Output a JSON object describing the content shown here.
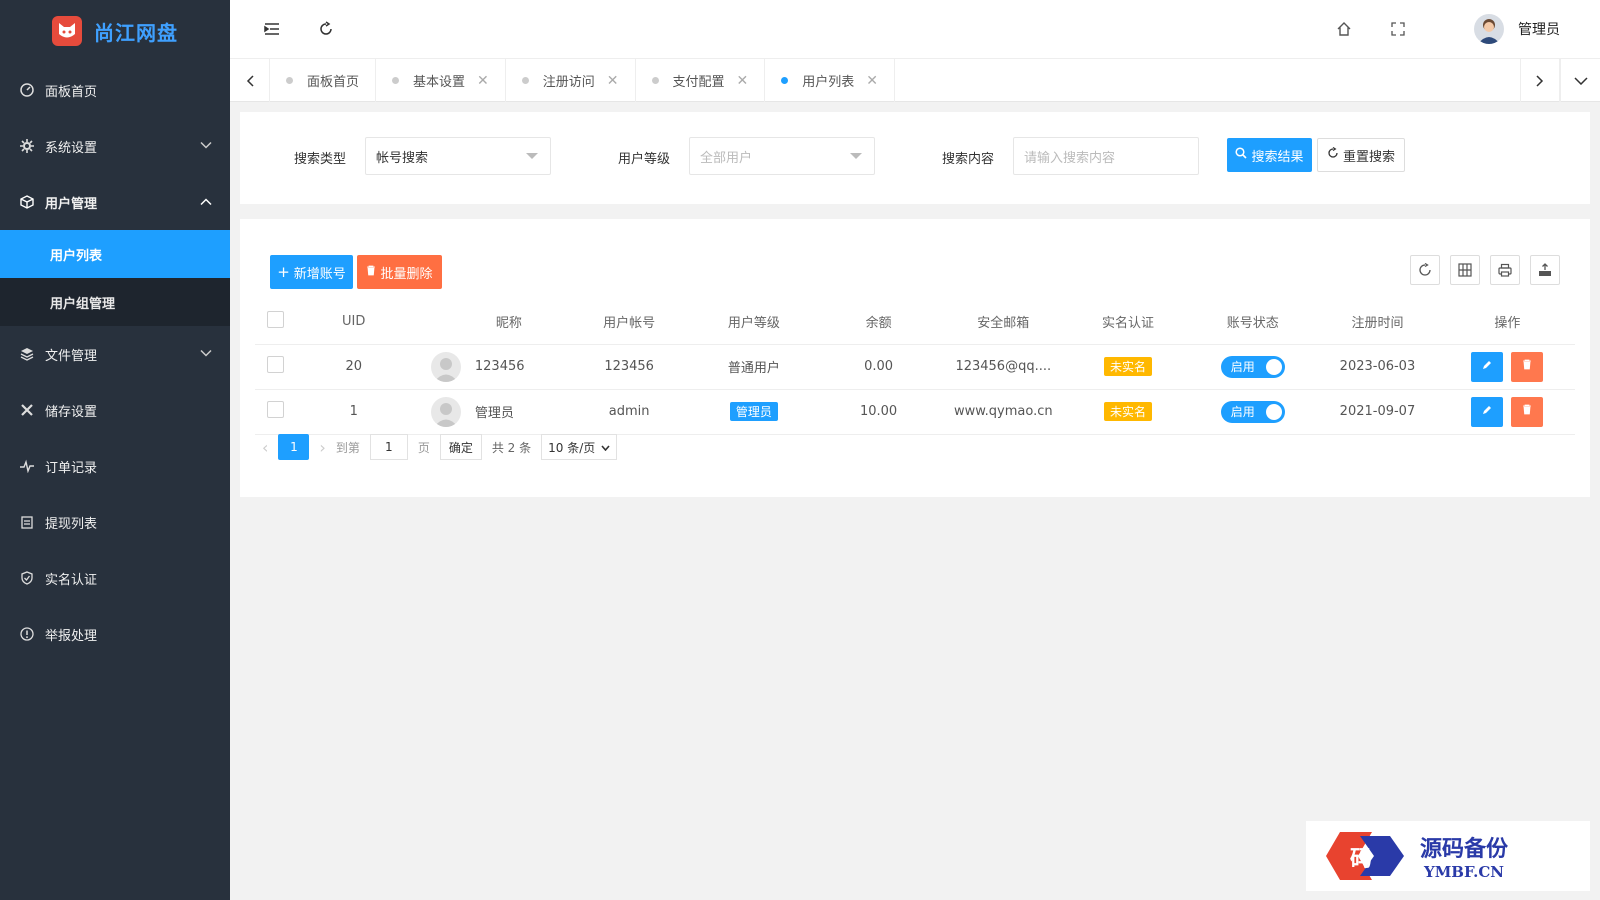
{
  "app": {
    "logo_text": "尚江网盘"
  },
  "sidebar": {
    "items": [
      {
        "label": "面板首页",
        "icon": "dashboard-icon"
      },
      {
        "label": "系统设置",
        "icon": "gear-icon"
      },
      {
        "label": "用户管理",
        "icon": "cube-icon"
      },
      {
        "label": "文件管理",
        "icon": "layers-icon"
      },
      {
        "label": "储存设置",
        "icon": "tools-icon"
      },
      {
        "label": "订单记录",
        "icon": "activity-icon"
      },
      {
        "label": "提现列表",
        "icon": "clipboard-icon"
      },
      {
        "label": "实名认证",
        "icon": "shield-icon"
      },
      {
        "label": "举报处理",
        "icon": "alert-icon"
      }
    ],
    "submenu": [
      {
        "label": "用户列表",
        "active": true
      },
      {
        "label": "用户组管理",
        "active": false
      }
    ]
  },
  "header": {
    "user_name": "管理员"
  },
  "tabs": [
    {
      "label": "面板首页",
      "closable": false
    },
    {
      "label": "基本设置",
      "closable": true
    },
    {
      "label": "注册访问",
      "closable": true
    },
    {
      "label": "支付配置",
      "closable": true
    },
    {
      "label": "用户列表",
      "closable": true,
      "active": true
    }
  ],
  "search": {
    "type_label": "搜索类型",
    "type_value": "帐号搜索",
    "level_label": "用户等级",
    "level_placeholder": "全部用户",
    "content_label": "搜索内容",
    "content_placeholder": "请输入搜索内容",
    "search_button": "搜索结果",
    "reset_button": "重置搜索"
  },
  "toolbar": {
    "add_button": "新增账号",
    "batch_delete_button": "批量删除"
  },
  "table": {
    "columns": [
      "UID",
      "昵称",
      "用户帐号",
      "用户等级",
      "余额",
      "安全邮箱",
      "实名认证",
      "账号状态",
      "注册时间",
      "操作"
    ],
    "rows": [
      {
        "uid": "20",
        "nickname": "123456",
        "account": "123456",
        "level": "普通用户",
        "level_badge": false,
        "balance": "0.00",
        "email": "123456@qq....",
        "verify": "未实名",
        "status": "启用",
        "registered": "2023-06-03"
      },
      {
        "uid": "1",
        "nickname": "管理员",
        "account": "admin",
        "level": "管理员",
        "level_badge": true,
        "balance": "10.00",
        "email": "www.qymao.cn",
        "verify": "未实名",
        "status": "启用",
        "registered": "2021-09-07"
      }
    ]
  },
  "pager": {
    "current": "1",
    "goto_label": "到第",
    "goto_value": "1",
    "page_unit": "页",
    "confirm": "确定",
    "total": "共 2 条",
    "page_size": "10 条/页"
  },
  "watermark": {
    "title": "源码备份",
    "sub": "YMBF.CN",
    "mark_char": "码"
  },
  "colors": {
    "sidebar_bg": "#28313d",
    "primary": "#1e9fff",
    "danger": "#ff5722",
    "warning": "#ffb800"
  }
}
